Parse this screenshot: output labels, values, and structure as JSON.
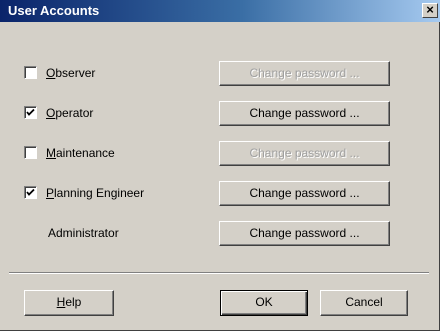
{
  "window": {
    "title": "User Accounts",
    "close_symbol": "×",
    "colors": {
      "titlebar_start": "#0a246a",
      "titlebar_end": "#a6caf0",
      "face": "#d4d0c8",
      "disabled_text": "#a0a0a0"
    }
  },
  "accounts": [
    {
      "prefix": "",
      "mnemonic": "O",
      "rest": "bserver",
      "checked": false,
      "has_checkbox": true,
      "button_label": "Change password ...",
      "button_enabled": false
    },
    {
      "prefix": "",
      "mnemonic": "O",
      "rest": "perator",
      "checked": true,
      "has_checkbox": true,
      "button_label": "Change password ...",
      "button_enabled": true
    },
    {
      "prefix": "",
      "mnemonic": "M",
      "rest": "aintenance",
      "checked": false,
      "has_checkbox": true,
      "button_label": "Change password ...",
      "button_enabled": false
    },
    {
      "prefix": "",
      "mnemonic": "P",
      "rest": "lanning Engineer",
      "checked": true,
      "has_checkbox": true,
      "button_label": "Change password ...",
      "button_enabled": true
    },
    {
      "label": "Administrator",
      "has_checkbox": false,
      "button_label": "Change password ...",
      "button_enabled": true
    }
  ],
  "footer": {
    "help_mnemonic": "H",
    "help_rest": "elp",
    "ok_label": "OK",
    "cancel_label": "Cancel"
  },
  "icons": {
    "check": "check-mark-icon",
    "close": "close-icon"
  }
}
